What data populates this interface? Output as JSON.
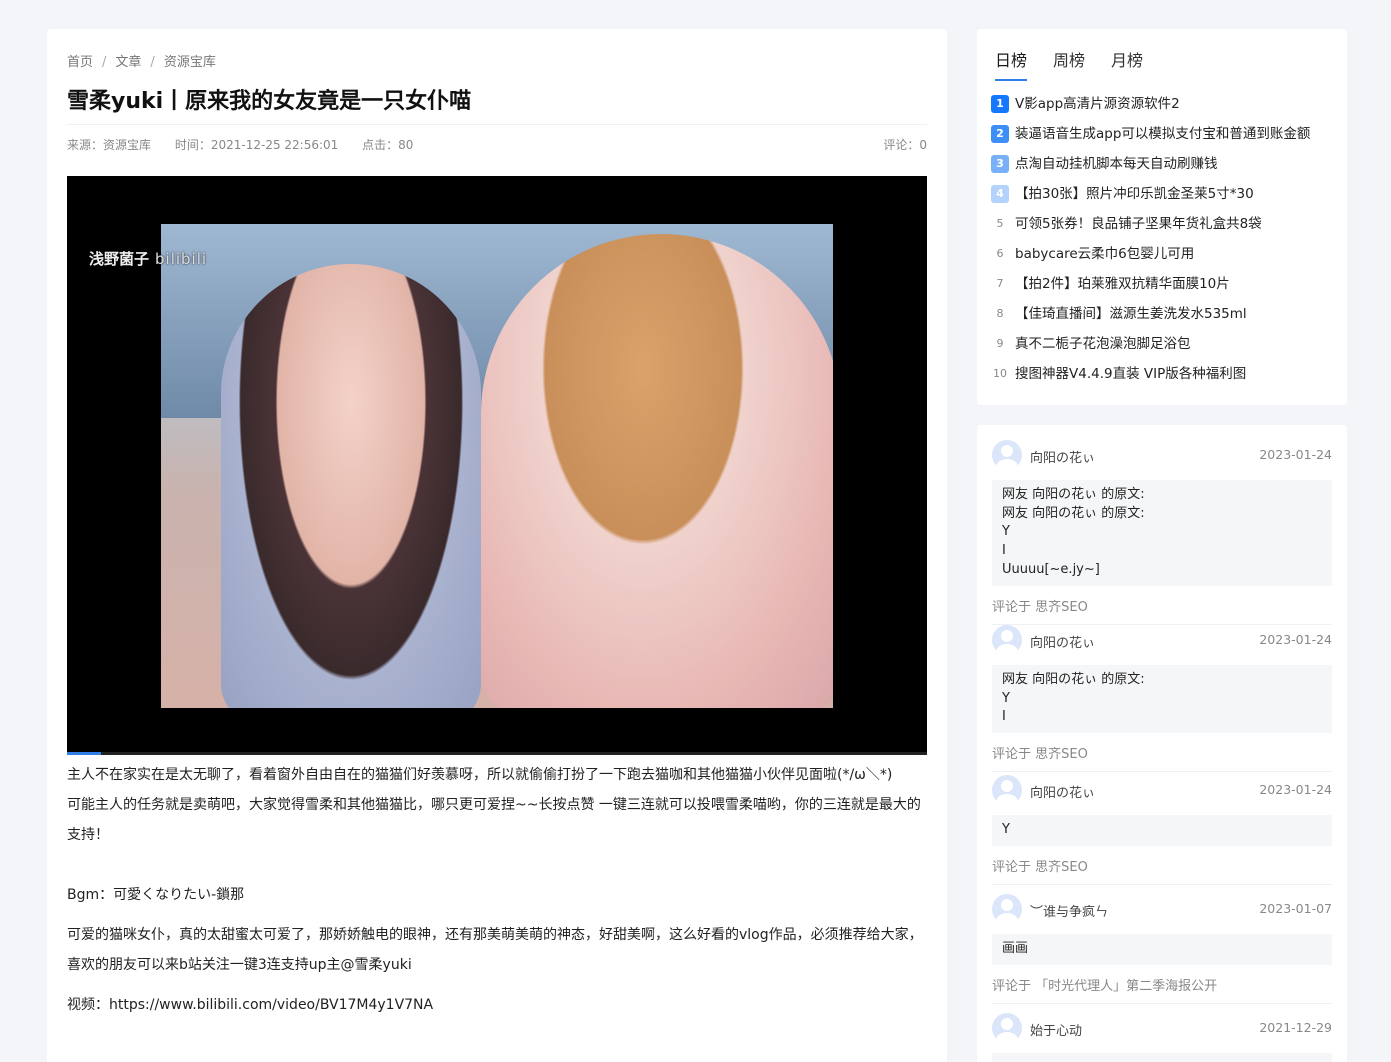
{
  "breadcrumb": [
    "首页",
    "文章",
    "资源宝库"
  ],
  "title": "雪柔yuki丨原来我的女友竟是一只女仆喵",
  "meta": {
    "source": "来源：资源宝库",
    "time": "时间：2021-12-25 22:56:01",
    "clicks": "点击：80",
    "comments": "评论：0"
  },
  "video": {
    "watermark": "浅野菌子",
    "logo": "bilibili",
    "progress": 0.04
  },
  "article": {
    "p1": "主人不在家实在是太无聊了，看着窗外自由自在的猫猫们好羡慕呀，所以就偷偷打扮了一下跑去猫咖和其他猫猫小伙伴见面啦(*/ω＼*)",
    "p2": "可能主人的任务就是卖萌吧，大家觉得雪柔和其他猫猫比，哪只更可爱捏~~长按点赞 一键三连就可以投喂雪柔喵哟，你的三连就是最大的支持！",
    "p3": "Bgm：可愛くなりたい-鎖那",
    "p4": "可爱的猫咪女仆，真的太甜蜜太可爱了，那娇娇触电的眼神，还有那美萌美萌的神态，好甜美啊，这么好看的vlog作品，必须推荐给大家，喜欢的朋友可以来b站关注一键3连支持up主@雪柔yuki",
    "p5": "视频：https://www.bilibili.com/video/BV17M4y1V7NA"
  },
  "rank": {
    "tabs": [
      "日榜",
      "周榜",
      "月榜"
    ],
    "items": [
      {
        "num": "1",
        "text": "V影app高清片源资源软件2"
      },
      {
        "num": "2",
        "text": "装逼语音生成app可以模拟支付宝和普通到账金额"
      },
      {
        "num": "3",
        "text": "点淘自动挂机脚本每天自动刷赚钱"
      },
      {
        "num": "4",
        "text": "【拍30张】照片冲印乐凯金圣莱5寸*30"
      },
      {
        "num": "5",
        "text": "可领5张券！良品铺子坚果年货礼盒共8袋"
      },
      {
        "num": "6",
        "text": "babycare云柔巾6包婴儿可用"
      },
      {
        "num": "7",
        "text": "【拍2件】珀莱雅双抗精华面膜10片"
      },
      {
        "num": "8",
        "text": "【佳琦直播间】滋源生姜洗发水535ml"
      },
      {
        "num": "9",
        "text": "真不二栀子花泡澡泡脚足浴包"
      },
      {
        "num": "10",
        "text": "搜图神器V4.4.9直装 VIP版各种福利图"
      }
    ]
  },
  "comments": [
    {
      "user": "向阳の花ぃ",
      "date": "2023-01-24",
      "lines": [
        "网友 向阳の花ぃ 的原文:",
        "网友 向阳の花ぃ 的原文:",
        "Y",
        "I",
        "Uuuuu[~e.jy~]"
      ],
      "target": "评论于 思齐SEO"
    },
    {
      "user": "向阳の花ぃ",
      "date": "2023-01-24",
      "lines": [
        "网友 向阳の花ぃ 的原文:",
        "Y",
        "I"
      ],
      "target": "评论于 思齐SEO"
    },
    {
      "user": "向阳の花ぃ",
      "date": "2023-01-24",
      "lines": [
        "Y"
      ],
      "target": "评论于 思齐SEO"
    },
    {
      "user": "︶谁与争疯ㄣ",
      "date": "2023-01-07",
      "lines": [
        "画画"
      ],
      "target": "评论于 「时光代理人」第二季海报公开"
    },
    {
      "user": "始于心动",
      "date": "2021-12-29",
      "lines": [
        ""
      ],
      "target": ""
    }
  ]
}
